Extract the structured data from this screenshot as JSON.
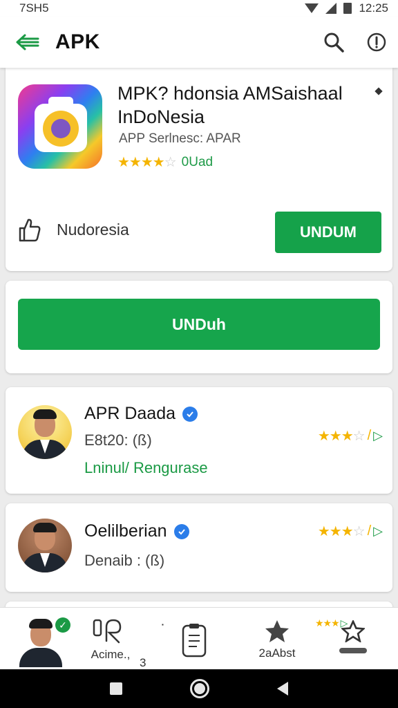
{
  "status_bar": {
    "left_text": "7SH5",
    "time": "12:25"
  },
  "app_bar": {
    "title": "APK"
  },
  "app_card": {
    "name": "MPK? hdonsia AMSaishaal InDoNesia",
    "subtitle": "APP Serlnesc: APAR",
    "rating_text": "0Uad",
    "stars_on": "★★★★",
    "stars_off": "☆",
    "country_label": "Nudoresia",
    "primary_button": "UNDUM"
  },
  "download": {
    "button_label": "UNDuh"
  },
  "developers": [
    {
      "name": "APR Daada",
      "meta": "E8t20: (ß)",
      "link": "Lninul/ Rengurase",
      "stars_on": "★★★",
      "stars_off": "☆",
      "rating_suffix": "/"
    },
    {
      "name": "Oelilberian",
      "meta": "Denaib : (ß)",
      "stars_on": "★★★",
      "stars_off": "☆",
      "rating_suffix": "/"
    }
  ],
  "tab_bar": {
    "tab2_label": "Acime.,",
    "tab2_sub": "3",
    "tab3_mark": "▪",
    "tab4_label": "2aAbst",
    "tab5_stars": "★★★"
  },
  "colors": {
    "green": "#16a54c",
    "star": "#f4b400",
    "verified": "#2b7de9"
  },
  "icons": [
    "back-arrow-icon",
    "search-icon",
    "info-icon",
    "thumbs-up-icon",
    "verified-icon",
    "star-icon",
    "clipboard-icon",
    "bookmark-icon"
  ]
}
